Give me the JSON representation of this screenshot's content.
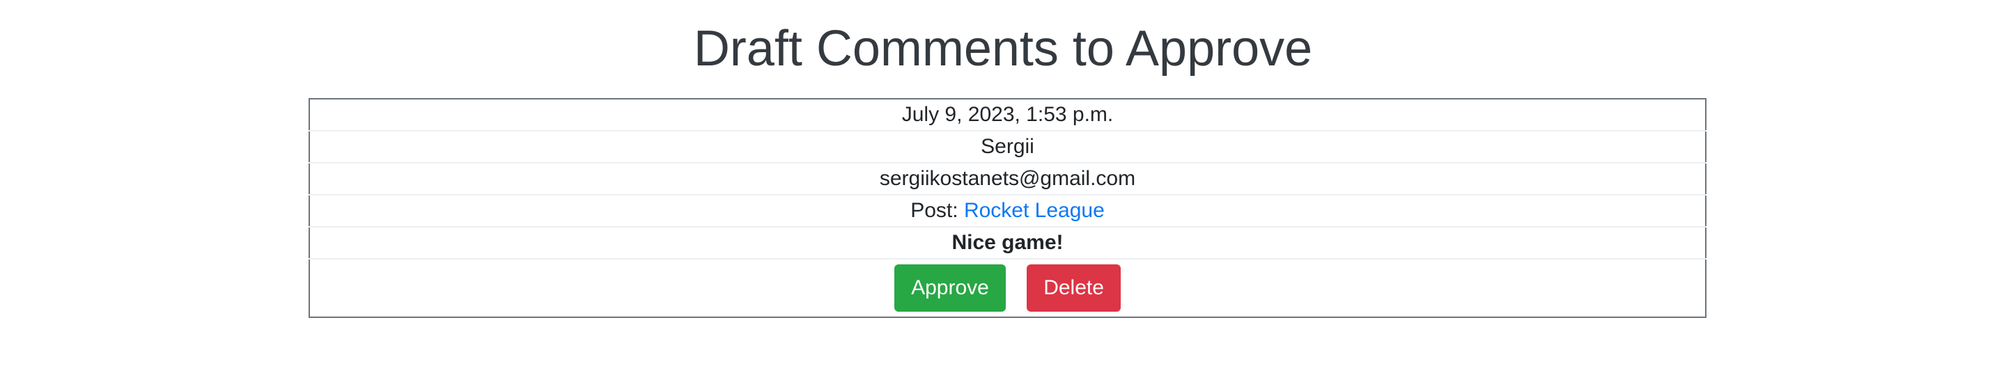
{
  "page": {
    "title": "Draft Comments to Approve"
  },
  "comment": {
    "date": "July 9, 2023, 1:53 p.m.",
    "author": "Sergii",
    "email": "sergiikostanets@gmail.com",
    "post_prefix": "Post: ",
    "post_title": "Rocket League",
    "text": "Nice game!"
  },
  "actions": {
    "approve_label": "Approve",
    "delete_label": "Delete"
  },
  "colors": {
    "approve": "#28a745",
    "delete": "#dc3545",
    "link": "#0d78f2",
    "title": "#343a40"
  }
}
